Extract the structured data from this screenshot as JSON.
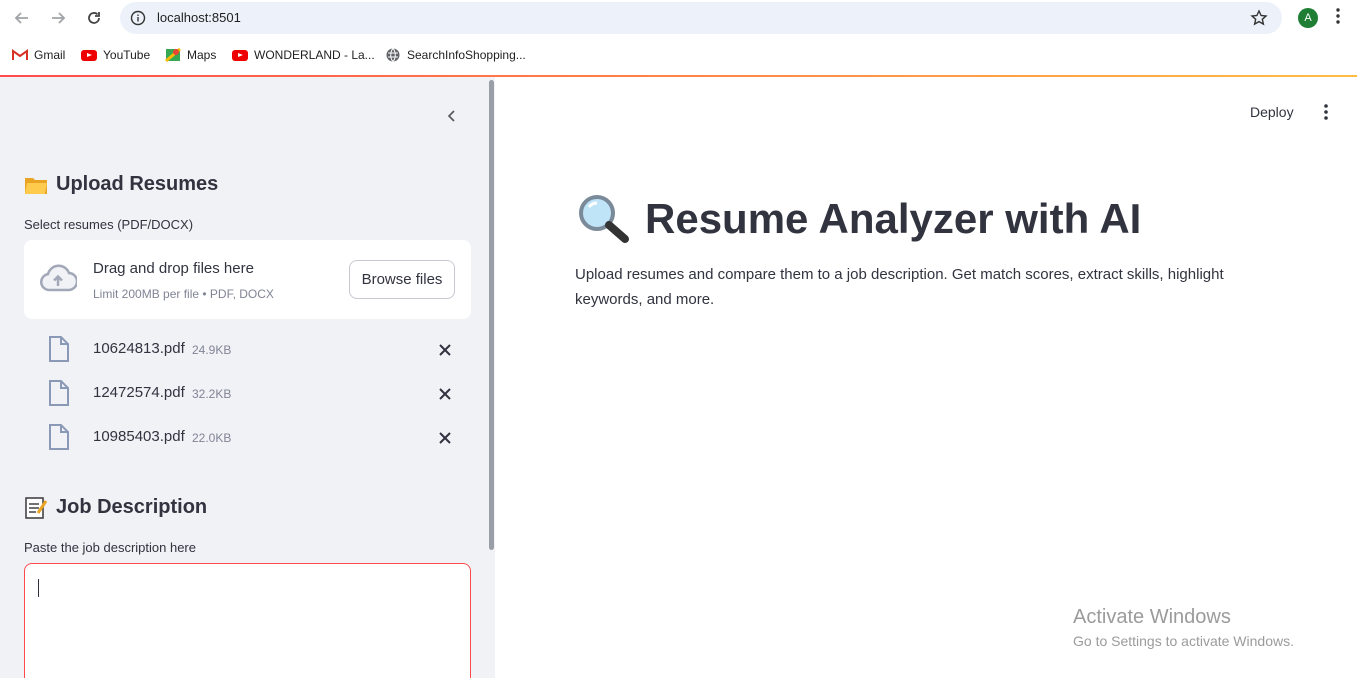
{
  "browser": {
    "url": "localhost:8501",
    "profile_initial": "A",
    "bookmarks": [
      {
        "label": "Gmail",
        "icon": "gmail-icon"
      },
      {
        "label": "YouTube",
        "icon": "youtube-icon"
      },
      {
        "label": "Maps",
        "icon": "maps-icon"
      },
      {
        "label": "WONDERLAND - La...",
        "icon": "youtube-icon"
      },
      {
        "label": "SearchInfoShopping...",
        "icon": "globe-icon"
      }
    ]
  },
  "sidebar": {
    "upload_heading": "Upload Resumes",
    "upload_label": "Select resumes (PDF/DOCX)",
    "dropzone_title": "Drag and drop files here",
    "dropzone_sub": "Limit 200MB per file • PDF, DOCX",
    "browse_label": "Browse files",
    "files": [
      {
        "name": "10624813.pdf",
        "size": "24.9KB"
      },
      {
        "name": "12472574.pdf",
        "size": "32.2KB"
      },
      {
        "name": "10985403.pdf",
        "size": "22.0KB"
      }
    ],
    "jd_heading": "Job Description",
    "jd_label": "Paste the job description here",
    "jd_value": ""
  },
  "main": {
    "deploy_label": "Deploy",
    "title": "Resume Analyzer with AI",
    "description": "Upload resumes and compare them to a job description. Get match scores, extract skills, highlight keywords, and more."
  },
  "watermark": {
    "line1": "Activate Windows",
    "line2": "Go to Settings to activate Windows."
  },
  "colors": {
    "accent": "#ff4b4b",
    "sidebar_bg": "#f0f2f6",
    "text": "#31333f"
  }
}
